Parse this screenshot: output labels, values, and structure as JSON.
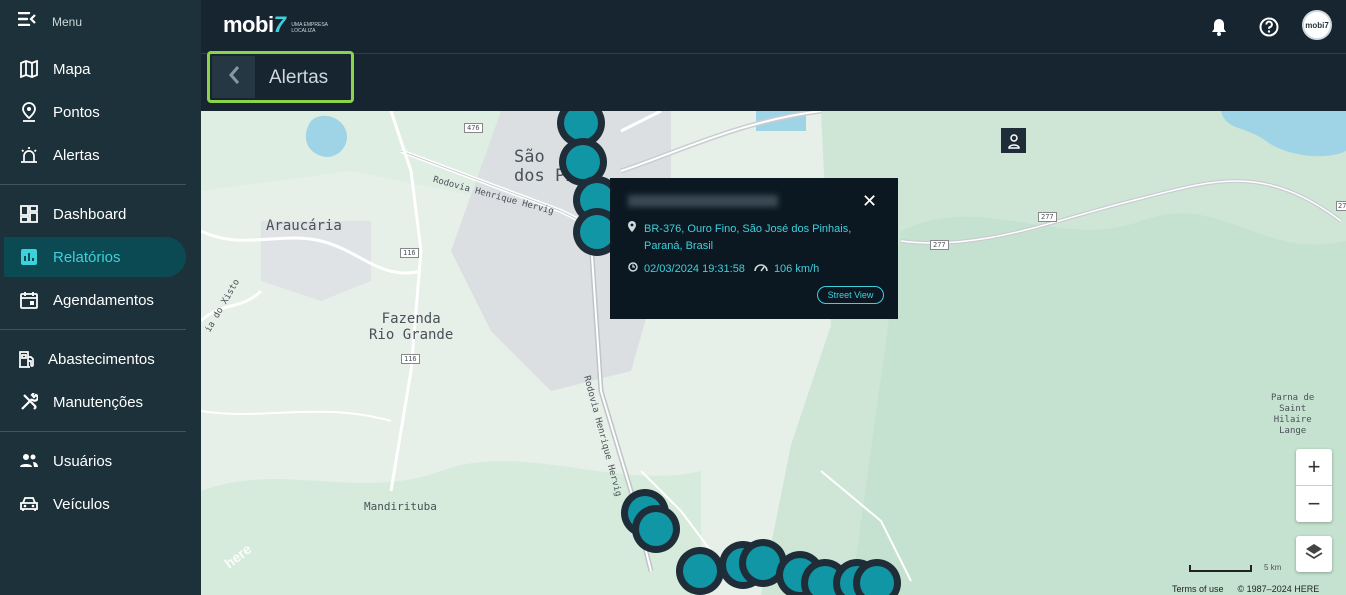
{
  "sidebar": {
    "menu_label": "Menu",
    "items": [
      {
        "label": "Mapa",
        "icon": "map-icon"
      },
      {
        "label": "Pontos",
        "icon": "location-pin-icon"
      },
      {
        "label": "Alertas",
        "icon": "siren-icon"
      },
      {
        "label": "Dashboard",
        "icon": "dashboard-icon"
      },
      {
        "label": "Relatórios",
        "icon": "bar-chart-icon",
        "active": true
      },
      {
        "label": "Agendamentos",
        "icon": "calendar-icon"
      },
      {
        "label": "Abastecimentos",
        "icon": "fuel-pump-icon"
      },
      {
        "label": "Manutenções",
        "icon": "tools-icon"
      },
      {
        "label": "Usuários",
        "icon": "users-icon"
      },
      {
        "label": "Veículos",
        "icon": "car-icon"
      }
    ]
  },
  "header": {
    "brand": "mobi",
    "brand_suffix": "7",
    "tagline": "UMA EMPRESA LOCALIZA",
    "avatar_text": "mobi7"
  },
  "page": {
    "title": "Alertas"
  },
  "map": {
    "labels": {
      "sao_jose": "São José dos Pinhais",
      "sao_line1": "São",
      "sao_line2": "dos Pi",
      "araucaria": "Araucária",
      "fazenda_line1": "Fazenda",
      "fazenda_line2": "Rio Grande",
      "mandirituba": "Mandirituba",
      "parna_line1": "Parna de",
      "parna_line2": "Saint",
      "parna_line3": "Hilaire",
      "parna_line4": "Lange",
      "rodovia1": "Rodovia Henrique Hervig",
      "rodovia2": "Rodovia Henrique Hervig",
      "rodovia_xisto": "ia do Xisto",
      "shield_476": "476",
      "shield_116a": "116",
      "shield_116b": "116",
      "shield_277a": "277",
      "shield_277b": "277",
      "shield_277c": "277"
    },
    "popup": {
      "address": "BR-376, Ouro Fino, São José dos Pinhais, Paraná, Brasil",
      "datetime": "02/03/2024 19:31:58",
      "speed": "106 km/h",
      "street_view": "Street View"
    },
    "scale_label": "5 km",
    "terms": "Terms of use",
    "copyright": "© 1987–2024 HERE",
    "watermark": "here",
    "zoom_in": "+",
    "zoom_out": "−"
  },
  "colors": {
    "sidebar_bg": "#1c3139",
    "header_bg": "#172531",
    "accent": "#3ed0db",
    "highlight_border": "#8bd44a",
    "marker_fill": "#1196a5"
  }
}
